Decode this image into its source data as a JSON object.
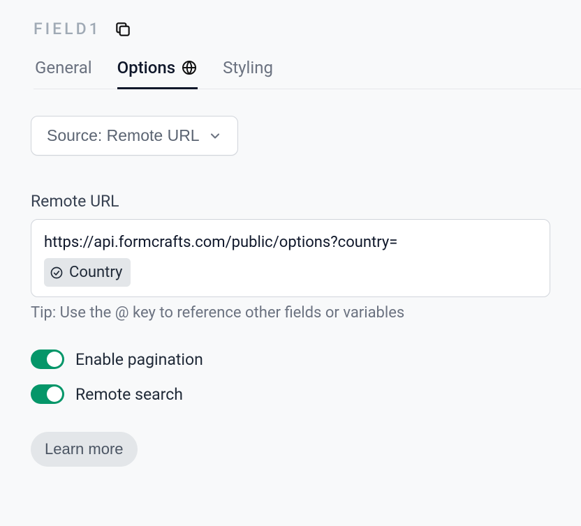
{
  "header": {
    "field_id": "FIELD1"
  },
  "tabs": {
    "general": "General",
    "options": "Options",
    "styling": "Styling"
  },
  "source": {
    "button_label": "Source: Remote URL"
  },
  "remote_url": {
    "label": "Remote URL",
    "value": "https://api.formcrafts.com/public/options?country=",
    "chip_label": "Country",
    "tip": "Tip: Use the @ key to reference other fields or variables"
  },
  "toggles": {
    "pagination": {
      "label": "Enable pagination",
      "on": true
    },
    "remote_search": {
      "label": "Remote search",
      "on": true
    }
  },
  "footer": {
    "learn_more": "Learn more"
  }
}
